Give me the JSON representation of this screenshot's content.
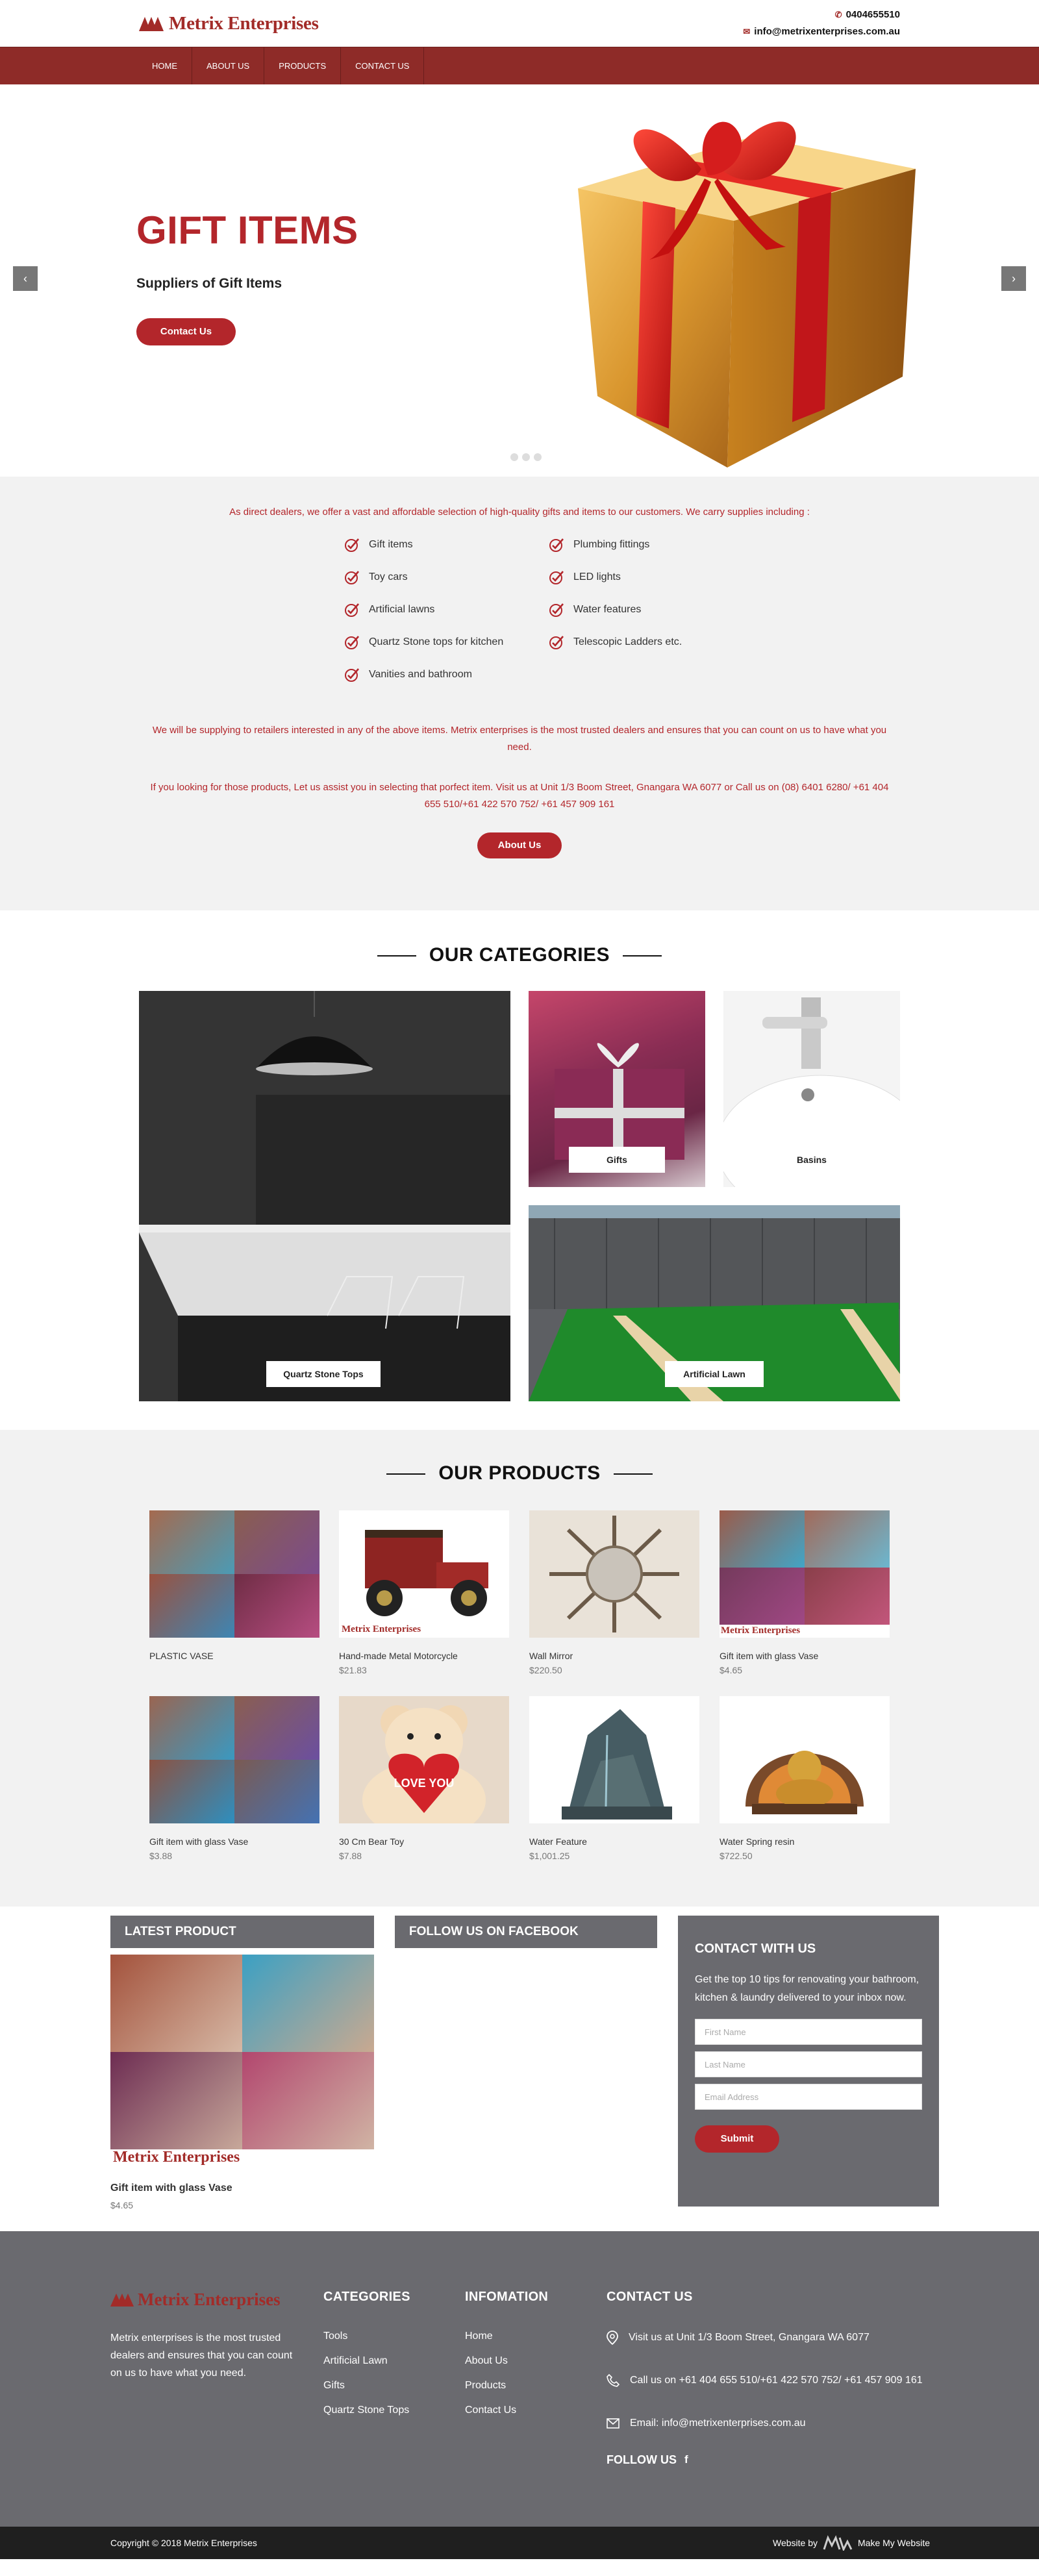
{
  "header": {
    "logo_text": "Metrix Enterprises",
    "phone": "0404655510",
    "email": "info@metrixenterprises.com.au"
  },
  "nav": [
    "HOME",
    "ABOUT US",
    "PRODUCTS",
    "CONTACT US"
  ],
  "hero": {
    "title": "GIFT ITEMS",
    "subtitle": "Suppliers of Gift Items",
    "button": "Contact Us",
    "prev": "‹",
    "next": "›"
  },
  "intro": {
    "lead": "As direct dealers, we offer a vast and affordable selection of high-quality gifts and items to our customers. We carry supplies including :",
    "items_left": [
      "Gift items",
      "Toy cars",
      "Artificial lawns",
      "Quartz Stone tops for kitchen",
      "Vanities and bathroom"
    ],
    "items_right": [
      "Plumbing fittings",
      "LED lights",
      "Water features",
      "Telescopic Ladders etc."
    ],
    "para1": "We will be supplying to retailers interested in any of the above items. Metrix enterprises is the most trusted dealers and ensures that you can count on us to have what you need.",
    "para2": "If you looking for those products, Let us assist you in selecting that porfect item. Visit us at Unit 1/3 Boom Street, Gnangara WA 6077 or Call us on (08) 6401 6280/ +61 404 655 510/+61 422 570 752/ +61 457 909 161",
    "button": "About Us"
  },
  "categories": {
    "title": "OUR CATEGORIES",
    "items": [
      "Quartz Stone Tops",
      "Gifts",
      "Basins",
      "Artificial Lawn"
    ]
  },
  "products": {
    "title": "OUR PRODUCTS",
    "items": [
      {
        "name": "PLASTIC VASE",
        "price": ""
      },
      {
        "name": "Hand-made Metal Motorcycle",
        "price": "$21.83"
      },
      {
        "name": "Wall Mirror",
        "price": "$220.50"
      },
      {
        "name": "Gift item with glass Vase",
        "price": "$4.65"
      },
      {
        "name": "Gift item with glass Vase",
        "price": "$3.88"
      },
      {
        "name": "30 Cm Bear Toy",
        "price": "$7.88"
      },
      {
        "name": "Water Feature",
        "price": "$1,001.25"
      },
      {
        "name": "Water Spring resin",
        "price": "$722.50"
      }
    ],
    "watermark": "Metrix Enterprises",
    "bear_text": "LOVE YOU"
  },
  "widgets": {
    "latest_title": "LATEST PRODUCT",
    "latest_name": "Gift item with glass Vase",
    "latest_price": "$4.65",
    "facebook_title": "FOLLOW US ON FACEBOOK",
    "contact_title": "CONTACT WITH US",
    "contact_text": "Get the top 10 tips for renovating your bathroom, kitchen & laundry delivered to your inbox now.",
    "first_name": "First Name",
    "last_name": "Last Name",
    "email": "Email Address",
    "submit": "Submit"
  },
  "footer": {
    "logo_text": "Metrix Enterprises",
    "about": "Metrix enterprises is the most trusted dealers and ensures that you can count on us to have what you need.",
    "categories_title": "CATEGORIES",
    "categories": [
      "Tools",
      "Artificial Lawn",
      "Gifts",
      "Quartz Stone Tops"
    ],
    "info_title": "INFOMATION",
    "info": [
      "Home",
      "About Us",
      "Products",
      "Contact Us"
    ],
    "contact_title": "CONTACT US",
    "address": "Visit us at Unit 1/3 Boom Street, Gnangara WA 6077",
    "phones": "Call us on +61 404 655 510/+61 422 570 752/ +61 457 909 161",
    "email": "Email: info@metrixenterprises.com.au",
    "follow": "FOLLOW US",
    "fb": "f"
  },
  "copyright": {
    "text": "Copyright © 2018 Metrix Enterprises",
    "website_by": "Website by",
    "brand": "Make My Website"
  },
  "colors": {
    "brand_red": "#b3262b",
    "nav_red": "#8e2b28",
    "grey_box": "#6a6a6f"
  }
}
